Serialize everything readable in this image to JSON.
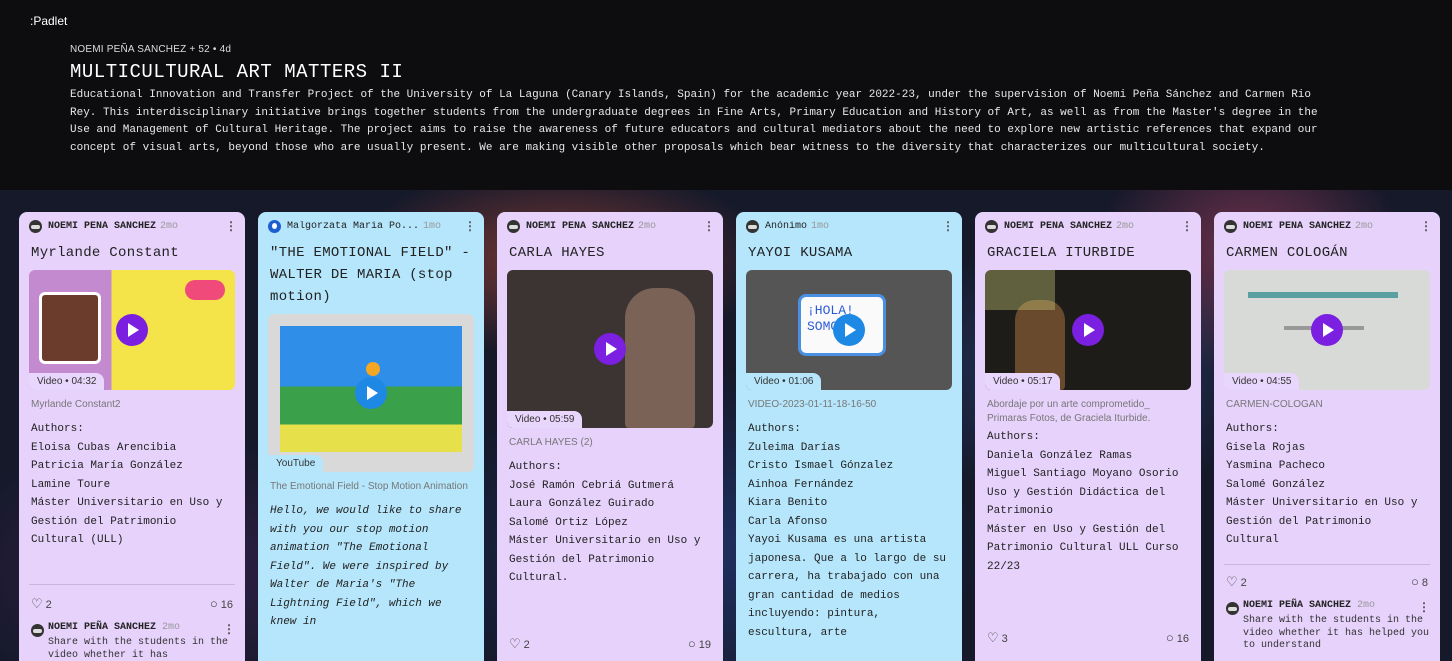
{
  "app": {
    "logo": ":Padlet"
  },
  "header": {
    "byline": "NOEMI PEÑA SANCHEZ + 52 • 4d",
    "title": "MULTICULTURAL ART MATTERS II",
    "description": "Educational Innovation and Transfer Project of the University of La Laguna (Canary Islands, Spain) for the academic year 2022-23, under the supervision of Noemi Peña Sánchez and Carmen Rio Rey. This interdisciplinary initiative brings together students from the undergraduate degrees in Fine Arts, Primary Education and History of Art, as well as from the Master's degree in the Use and Management of Cultural Heritage. The project aims to raise the awareness of future educators and cultural mediators about the need to explore new artistic references that expand our concept of visual arts, beyond those who are usually present. We are making visible other proposals which bear witness to the diversity that characterizes our multicultural society."
  },
  "cards": [
    {
      "author": "NOEMI PEÑA SANCHEZ",
      "ago": "2mo",
      "title": "Myrlande Constant",
      "video_label": "Video • 04:32",
      "caption": "Myrlande Constant2",
      "body": "Authors:\nEloisa Cubas Arencibia\nPatricia María González\nLamine Toure\nMáster Universitario en Uso y Gestión del Patrimonio Cultural (ULL)",
      "likes": "2",
      "comments": "16",
      "comment_author": "NOEMI PEÑA SANCHEZ",
      "comment_ago": "2mo",
      "comment_text": "Share with the students in the video whether it has"
    },
    {
      "author": "Malgorzata Maria Po...",
      "ago": "1mo",
      "title": "\"THE EMOTIONAL FIELD\" - WALTER DE MARIA (stop motion)",
      "video_label": "YouTube",
      "caption": "The Emotional Field - Stop Motion Animation",
      "body": "Hello, we would like to share with you our stop motion animation \"The Emotional Field\". We were inspired by Walter de Maria's \"The Lightning Field\", which we knew in"
    },
    {
      "author": "NOEMI PEÑA SANCHEZ",
      "ago": "2mo",
      "title": "CARLA HAYES",
      "video_label": "Video • 05:59",
      "caption": "CARLA HAYES (2)",
      "body": "Authors:\nJosé Ramón Cebriá Gutmerá\nLaura González Guirado\nSalomé Ortiz López\nMáster Universitario en Uso y Gestión del Patrimonio Cultural.",
      "likes": "2",
      "comments": "19"
    },
    {
      "author": "Anónimo",
      "ago": "1mo",
      "title": "YAYOI KUSAMA",
      "video_label": "Video • 01:06",
      "caption": "VIDEO-2023-01-11-18-16-50",
      "thumb_text": "¡HOLA! SOMOS",
      "body": "Authors:\nZuleima Darías\nCristo Ismael Gónzalez\nAinhoa Fernández\nKiara Benito\nCarla Afonso\nYayoi Kusama  es una artista japonesa. Que a lo largo de su carrera, ha trabajado con una gran cantidad de medios incluyendo: pintura, escultura, arte"
    },
    {
      "author": "NOEMI PEÑA SANCHEZ",
      "ago": "2mo",
      "title": "GRACIELA ITURBIDE",
      "video_label": "Video • 05:17",
      "caption": "Abordaje por un arte comprometido_ Primaras Fotos, de Graciela Iturbide.",
      "body": "Authors:\nDaniela González Ramas\nMiguel Santiago Moyano Osorio\nUso y Gestión Didáctica del Patrimonio\nMáster en Uso y Gestión del Patrimonio Cultural ULL Curso 22/23",
      "likes": "3",
      "comments": "16"
    },
    {
      "author": "NOEMI PEÑA SANCHEZ",
      "ago": "2mo",
      "title": "CARMEN COLOGÁN",
      "video_label": "Video • 04:55",
      "caption": "CARMEN-COLOGAN",
      "body": "Authors:\nGisela Rojas\nYasmina Pacheco\nSalomé González\nMáster Universitario en Uso y Gestión del Patrimonio Cultural",
      "likes": "2",
      "comments": "8",
      "comment_author": "NOEMI PEÑA SANCHEZ",
      "comment_ago": "2mo",
      "comment_text": "Share with the students in the video whether it has helped you to understand"
    }
  ],
  "colors": {
    "purple_card": "#e6d2fb",
    "blue_card": "#b5e6fb",
    "play_button": "#7b1fe0"
  },
  "icons": {
    "menu": "kebab-menu-icon",
    "play": "play-icon",
    "like": "heart-icon",
    "comment": "comment-icon"
  }
}
